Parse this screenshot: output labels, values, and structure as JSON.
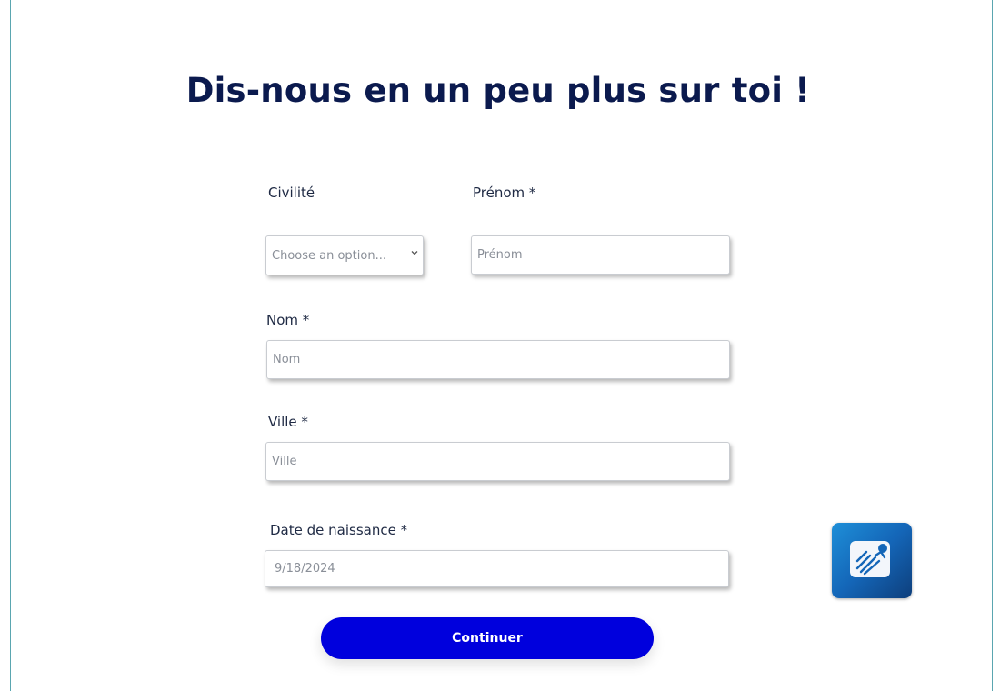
{
  "page": {
    "title": "Dis-nous en un peu plus sur toi !"
  },
  "form": {
    "civilite": {
      "label": "Civilité",
      "selected": "Choose an option..."
    },
    "prenom": {
      "label": "Prénom *",
      "placeholder": "Prénom"
    },
    "nom": {
      "label": "Nom *",
      "placeholder": "Nom"
    },
    "ville": {
      "label": "Ville *",
      "placeholder": "Ville"
    },
    "date_naissance": {
      "label": "Date de naissance *",
      "placeholder": "9/18/2024"
    },
    "submit_label": "Continuer"
  },
  "widget": {
    "icon": "app-launcher-icon",
    "colors": {
      "accent": "#0000dd",
      "title": "#0b1a4e"
    }
  }
}
